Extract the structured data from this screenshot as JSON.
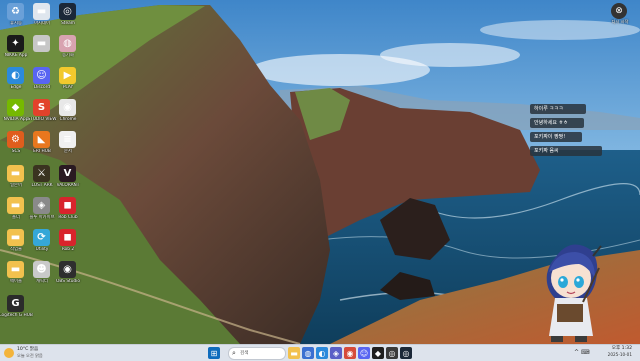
{
  "desktop": {
    "icons": [
      {
        "id": "recycle",
        "label": "휴지통",
        "glyph": "♻",
        "color": "#6aa0d8"
      },
      {
        "id": "app2",
        "label": "마지데이",
        "glyph": "▬",
        "color": "#dfe6ee"
      },
      {
        "id": "steam",
        "label": "Steam",
        "glyph": "◎",
        "color": "#1b2838"
      },
      {
        "id": "nikke",
        "label": "NIKKE App",
        "glyph": "✦",
        "color": "#1a1a1a"
      },
      {
        "id": "app5",
        "label": "",
        "glyph": "▬",
        "color": "#c7c7c7"
      },
      {
        "id": "app6",
        "label": "동기화",
        "glyph": "◍",
        "color": "#d8a3b0"
      },
      {
        "id": "edge",
        "label": "Edge",
        "glyph": "◐",
        "color": "#2c8adb"
      },
      {
        "id": "discord",
        "label": "Discord",
        "glyph": "☺",
        "color": "#5865f2"
      },
      {
        "id": "playtime",
        "label": "PLAY",
        "glyph": "▶",
        "color": "#f2c92d"
      },
      {
        "id": "nvidia",
        "label": "NVIDIA App",
        "glyph": "◆",
        "color": "#76b900"
      },
      {
        "id": "studio",
        "label": "STUDIO VIEW",
        "glyph": "S",
        "color": "#e2422b"
      },
      {
        "id": "chrome",
        "label": "Chrome",
        "glyph": "◉",
        "color": "#e8e8e8"
      },
      {
        "id": "app13",
        "label": "SCS",
        "glyph": "⚙",
        "color": "#e05d1d"
      },
      {
        "id": "hub",
        "label": "ERI HUB",
        "glyph": "◣",
        "color": "#e8771e"
      },
      {
        "id": "doc",
        "label": "문서",
        "glyph": "≡",
        "color": "#f0f0f0"
      },
      {
        "id": "folder1",
        "label": "일본어",
        "glyph": "▬",
        "color": "#f2c14e"
      },
      {
        "id": "lostark",
        "label": "LOST ARK",
        "glyph": "⚔",
        "color": "#3a3320"
      },
      {
        "id": "valorant",
        "label": "VALORANT",
        "glyph": "V",
        "color": "#2a1a22"
      },
      {
        "id": "folder2",
        "label": "폴더",
        "glyph": "▬",
        "color": "#f2c14e"
      },
      {
        "id": "app20",
        "label": "블루 아카이브",
        "glyph": "◈",
        "color": "#8a8a8a"
      },
      {
        "id": "roblox",
        "label": "Rob Club",
        "glyph": "◼",
        "color": "#d8242c"
      },
      {
        "id": "folder3",
        "label": "작업물",
        "glyph": "▬",
        "color": "#f2c14e"
      },
      {
        "id": "app23",
        "label": "Utility",
        "glyph": "⟳",
        "color": "#35a7d8"
      },
      {
        "id": "app24",
        "label": "Rob 2",
        "glyph": "◼",
        "color": "#d8242c"
      },
      {
        "id": "folder4",
        "label": "메이플",
        "glyph": "▬",
        "color": "#f2c14e"
      },
      {
        "id": "app26",
        "label": "캐릭터",
        "glyph": "☻",
        "color": "#c9c9c9"
      },
      {
        "id": "obs",
        "label": "OBS Studio",
        "glyph": "◉",
        "color": "#2e2e2e"
      },
      {
        "id": "logi",
        "label": "Logitech G HUB",
        "glyph": "G",
        "color": "#2b2b2b"
      }
    ],
    "top_right_widget": {
      "glyph": "⊗",
      "label": "다시 시작"
    },
    "chat_overlay": {
      "messages": [
        "하이루 ㅋㅋㅋ",
        "안녕하세요 ㅎㅎ",
        "포키짜이 짱짱!",
        "포키짜 음씨"
      ]
    }
  },
  "taskbar": {
    "weather": {
      "temp": "10°C 맑음",
      "detail": "오늘 오전 맑음"
    },
    "search": {
      "placeholder": "검색"
    },
    "apps": [
      {
        "id": "start",
        "glyph": "⊞",
        "color": "#0f6cbd"
      },
      {
        "id": "tb-search-app",
        "glyph": "⌕",
        "color": "#7a7a7a"
      },
      {
        "id": "files",
        "glyph": "▬",
        "color": "#f2c14e"
      },
      {
        "id": "widgets",
        "glyph": "◍",
        "color": "#3b6fd1"
      },
      {
        "id": "edge",
        "glyph": "◐",
        "color": "#2c8adb"
      },
      {
        "id": "store",
        "glyph": "◈",
        "color": "#5b5fc7"
      },
      {
        "id": "chrome",
        "glyph": "◉",
        "color": "#d64b3a"
      },
      {
        "id": "discord",
        "glyph": "☺",
        "color": "#5865f2"
      },
      {
        "id": "app9",
        "glyph": "◆",
        "color": "#1f1f1f"
      },
      {
        "id": "app10",
        "glyph": "◎",
        "color": "#3a3a3a"
      },
      {
        "id": "steam",
        "glyph": "◎",
        "color": "#1b2838"
      }
    ],
    "tray": "^ ⌨ ",
    "clock": {
      "time": "오후 1:32",
      "date": "2025-10-01"
    }
  }
}
